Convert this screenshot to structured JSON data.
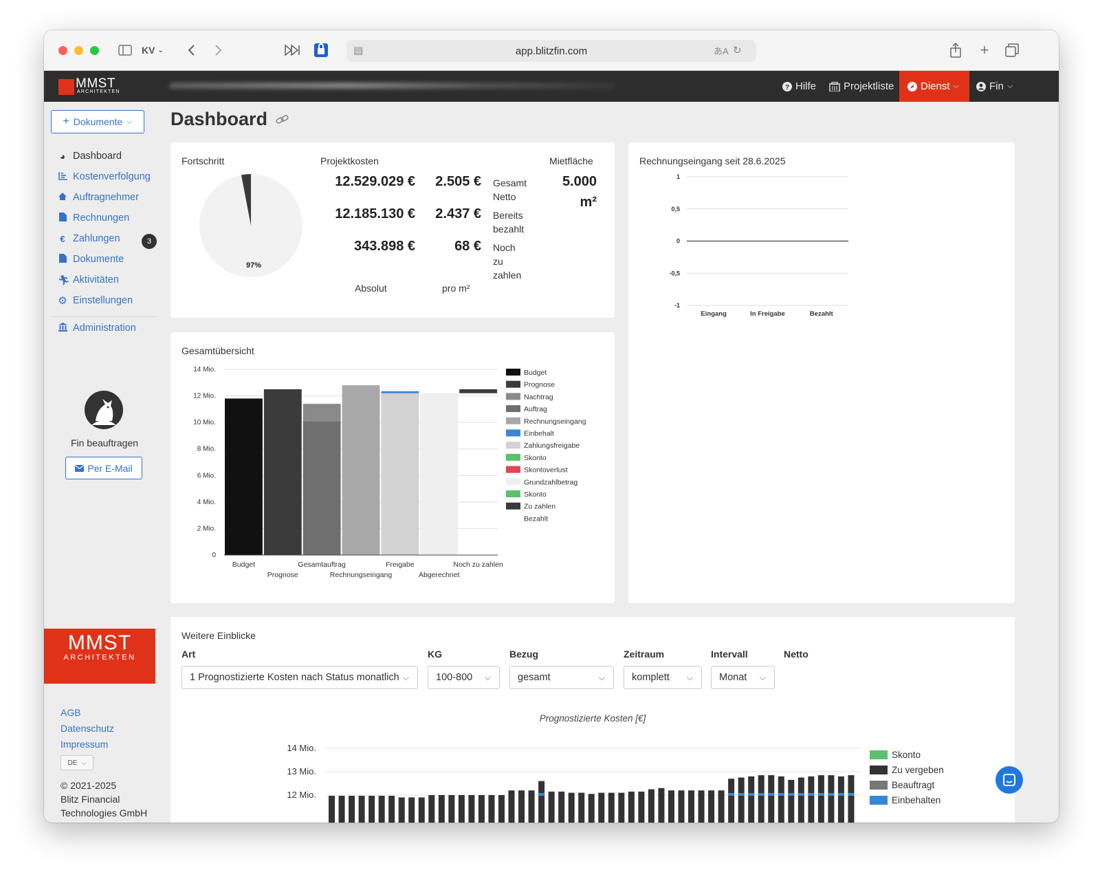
{
  "browser": {
    "url": "app.blitzfin.com",
    "tab_group": "KV"
  },
  "header": {
    "logo_text": "MMST",
    "logo_sub": "ARCHITEKTEN",
    "help": "Hilfe",
    "projects": "Projektliste",
    "service": "Dienst",
    "user": "Fin"
  },
  "sidebar": {
    "documents_button": "Dokumente",
    "items": [
      {
        "label": "Dashboard",
        "icon": "gauge-icon"
      },
      {
        "label": "Kostenverfolgung",
        "icon": "chart-icon"
      },
      {
        "label": "Auftragnehmer",
        "icon": "contractor-icon"
      },
      {
        "label": "Rechnungen",
        "icon": "file-icon"
      },
      {
        "label": "Zahlungen",
        "icon": "euro-icon",
        "badge": "3"
      },
      {
        "label": "Dokumente",
        "icon": "file-icon"
      },
      {
        "label": "Aktivitäten",
        "icon": "activity-icon"
      },
      {
        "label": "Einstellungen",
        "icon": "gear-icon"
      }
    ],
    "admin": "Administration",
    "assign_label": "Fin beauftragen",
    "email_button": "Per E-Mail",
    "footer_logo": "MMST",
    "footer_logo_sub": "ARCHITEKTEN",
    "links": [
      "AGB",
      "Datenschutz",
      "Impressum"
    ],
    "language": "DE",
    "copyright_1": "© 2021-2025",
    "copyright_2": "Blitz Financial",
    "copyright_3": "Technologies GmbH"
  },
  "main": {
    "title": "Dashboard"
  },
  "summary": {
    "progress_label": "Fortschritt",
    "progress_value": "97%",
    "progress_fraction": 0.97,
    "costs_label": "Projektkosten",
    "area_label": "Mietfläche",
    "area_value": "5.000",
    "area_unit": "m²",
    "rows": [
      {
        "absolute": "12.529.029 €",
        "per_sqm": "2.505 €",
        "label_1": "Gesamt",
        "label_2": "Netto",
        "label_3": ""
      },
      {
        "absolute": "12.185.130 €",
        "per_sqm": "2.437 €",
        "label_1": "Bereits",
        "label_2": "bezahlt",
        "label_3": ""
      },
      {
        "absolute": "343.898 €",
        "per_sqm": "68 €",
        "label_1": "Noch",
        "label_2": "zu",
        "label_3": "zahlen"
      }
    ],
    "col_absolute": "Absolut",
    "col_per_sqm": "pro m²"
  },
  "invoice_card": {
    "title": "Rechnungseingang seit 28.6.2025"
  },
  "overview_card": {
    "title": "Gesamtübersicht"
  },
  "insights": {
    "title": "Weitere Einblicke",
    "filters": {
      "art_label": "Art",
      "art_value": "1 Prognostizierte Kosten nach Status monatlich",
      "kg_label": "KG",
      "kg_value": "100-800",
      "bezug_label": "Bezug",
      "bezug_value": "gesamt",
      "zeitraum_label": "Zeitraum",
      "zeitraum_value": "komplett",
      "intervall_label": "Intervall",
      "intervall_value": "Monat",
      "netto_label": "Netto"
    }
  },
  "colors": {
    "accent": "#3572c9",
    "brand_red": "#e03218",
    "header_bg": "#2d2d2d"
  },
  "chart_data": [
    {
      "type": "bar",
      "title": "Rechnungseingang seit 28.6.2025",
      "categories": [
        "Eingang",
        "In Freigabe",
        "Bezahlt"
      ],
      "values": [
        0,
        0,
        0
      ],
      "ylim": [
        -1,
        1
      ],
      "yticks": [
        "1",
        "0,5",
        "0",
        "-0,5",
        "-1"
      ],
      "grid": true
    },
    {
      "type": "bar",
      "title": "Gesamtübersicht",
      "categories": [
        "Budget",
        "Prognose",
        "Gesamtauftrag",
        "Rechnungseingang",
        "Freigabe",
        "Abgerechnet",
        "Noch zu zahlen"
      ],
      "segments": [
        [
          {
            "series": "Budget",
            "from": 0,
            "to": 11.8
          }
        ],
        [
          {
            "series": "Prognose",
            "from": 0,
            "to": 12.5
          }
        ],
        [
          {
            "series": "Auftrag",
            "from": 0,
            "to": 10.1
          },
          {
            "series": "Nachtrag",
            "from": 10.1,
            "to": 11.4
          }
        ],
        [
          {
            "series": "Rechnungseingang",
            "from": 0,
            "to": 12.8
          }
        ],
        [
          {
            "series": "Zahlungsfreigabe",
            "from": 0,
            "to": 12.2
          },
          {
            "series": "Einbehalt",
            "from": 12.2,
            "to": 12.35
          }
        ],
        [
          {
            "series": "Grundzahlbetrag",
            "from": 0,
            "to": 12.2
          }
        ],
        [
          {
            "series": "Zu zahlen",
            "from": 12.2,
            "to": 12.5
          }
        ]
      ],
      "legend": [
        {
          "name": "Budget",
          "color": "#111111"
        },
        {
          "name": "Prognose",
          "color": "#3b3b3b"
        },
        {
          "name": "Nachtrag",
          "color": "#8a8a8a"
        },
        {
          "name": "Auftrag",
          "color": "#6f6f6f"
        },
        {
          "name": "Rechnungseingang",
          "color": "#a8a8a8"
        },
        {
          "name": "Einbehalt",
          "color": "#3a86d6"
        },
        {
          "name": "Zahlungsfreigabe",
          "color": "#d2d2d2"
        },
        {
          "name": "Skonto",
          "color": "#5cc06e"
        },
        {
          "name": "Skontoverlust",
          "color": "#e04653"
        },
        {
          "name": "Grundzahlbetrag",
          "color": "#efefef"
        },
        {
          "name": "Skonto",
          "color": "#5cc06e"
        },
        {
          "name": "Zu zahlen",
          "color": "#3b3b3b"
        },
        {
          "name": "Bezahlt",
          "color": ""
        }
      ],
      "yticks": [
        "14 Mio.",
        "12 Mio.",
        "10 Mio.",
        "8 Mio.",
        "6 Mio.",
        "4 Mio.",
        "2 Mio.",
        "0"
      ],
      "ylim": [
        0,
        14
      ],
      "legend_position": "right"
    },
    {
      "type": "bar",
      "title": "Prognostizierte Kosten [€]",
      "ylim": [
        12,
        14
      ],
      "yticks": [
        "14 Mio.",
        "13 Mio.",
        "12 Mio."
      ],
      "values": [
        11.97,
        11.97,
        11.97,
        11.97,
        11.97,
        11.97,
        11.97,
        11.9,
        11.9,
        11.9,
        12.0,
        12.0,
        12.0,
        12.0,
        12.0,
        12.0,
        12.0,
        12.0,
        12.2,
        12.2,
        12.2,
        12.6,
        12.15,
        12.15,
        12.1,
        12.1,
        12.05,
        12.1,
        12.1,
        12.1,
        12.15,
        12.15,
        12.25,
        12.3,
        12.2,
        12.2,
        12.2,
        12.2,
        12.2,
        12.2,
        12.7,
        12.75,
        12.8,
        12.85,
        12.85,
        12.8,
        12.65,
        12.75,
        12.8,
        12.85,
        12.85,
        12.8,
        12.85
      ],
      "legend": [
        {
          "name": "Skonto",
          "color": "#5cc06e"
        },
        {
          "name": "Zu vergeben",
          "color": "#333333"
        },
        {
          "name": "Beauftragt",
          "color": "#777777"
        },
        {
          "name": "Einbehalten",
          "color": "#3a86d6"
        }
      ],
      "legend_position": "right"
    }
  ]
}
